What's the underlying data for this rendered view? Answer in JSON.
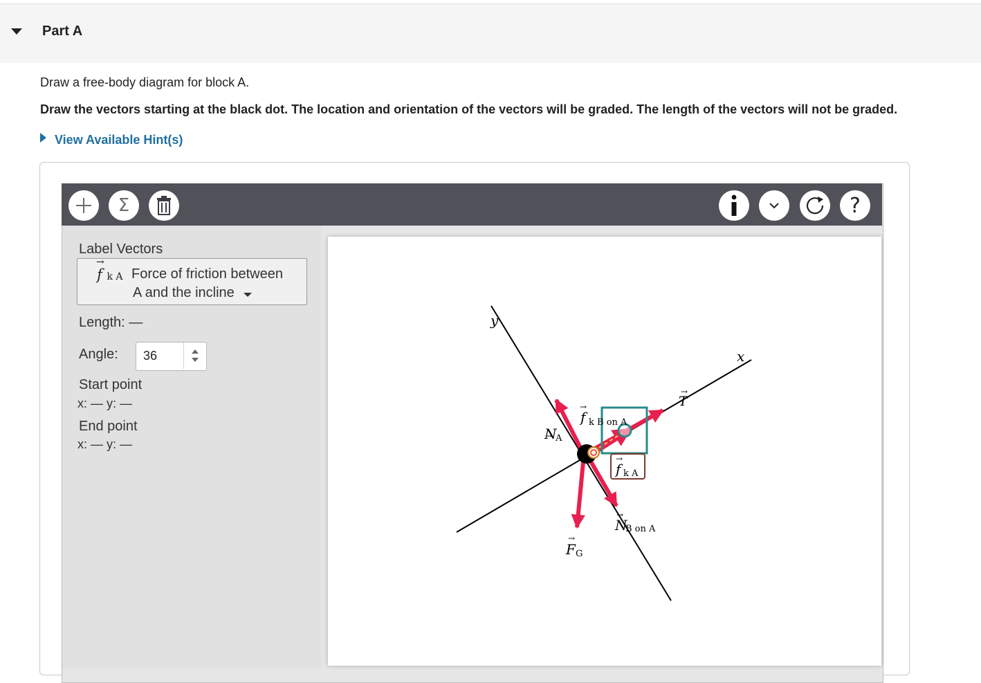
{
  "part": {
    "title": "Part A"
  },
  "instructions": {
    "line1": "Draw a free-body diagram for block A.",
    "line2": "Draw the vectors starting at the black dot. The location and orientation of the vectors will be graded. The length of the vectors will not be graded."
  },
  "hints": {
    "label": "View Available Hint(s)"
  },
  "toolbar": {
    "left_buttons": [
      "plus-icon",
      "sigma-icon",
      "trash-icon"
    ],
    "right_buttons": [
      "info-icon",
      "chevron-down-icon",
      "reset-icon",
      "help-icon"
    ],
    "sigma": "Σ",
    "help": "?"
  },
  "panel": {
    "label_vectors": "Label Vectors",
    "selected_vector": {
      "symbol": "f",
      "subscript": "k A",
      "description_line1": "Force of friction between",
      "description_line2": "A and the incline"
    },
    "length_label": "Length:",
    "length_value": "—",
    "angle_label": "Angle:",
    "angle_value": "36",
    "start_point_label": "Start point",
    "start_point_value": "x: — y: —",
    "end_point_label": "End point",
    "end_point_value": "x: — y: —"
  },
  "diagram": {
    "axis_x": "x",
    "axis_y": "y",
    "vector_labels": {
      "normal_a": {
        "symbol": "N",
        "sub": "A"
      },
      "friction_b_on_a": {
        "symbol": "f",
        "sub": "k B on A"
      },
      "tension": {
        "symbol": "T",
        "sub": ""
      },
      "gravity": {
        "symbol": "F",
        "sub": "G"
      },
      "normal_b_on_a": {
        "symbol": "N",
        "sub": "B on A"
      },
      "friction_k_a": {
        "symbol": "f",
        "sub": "k A"
      }
    },
    "colors": {
      "vector": "#e8204f",
      "selection": "#2a8a8a",
      "axis": "#000000"
    }
  }
}
